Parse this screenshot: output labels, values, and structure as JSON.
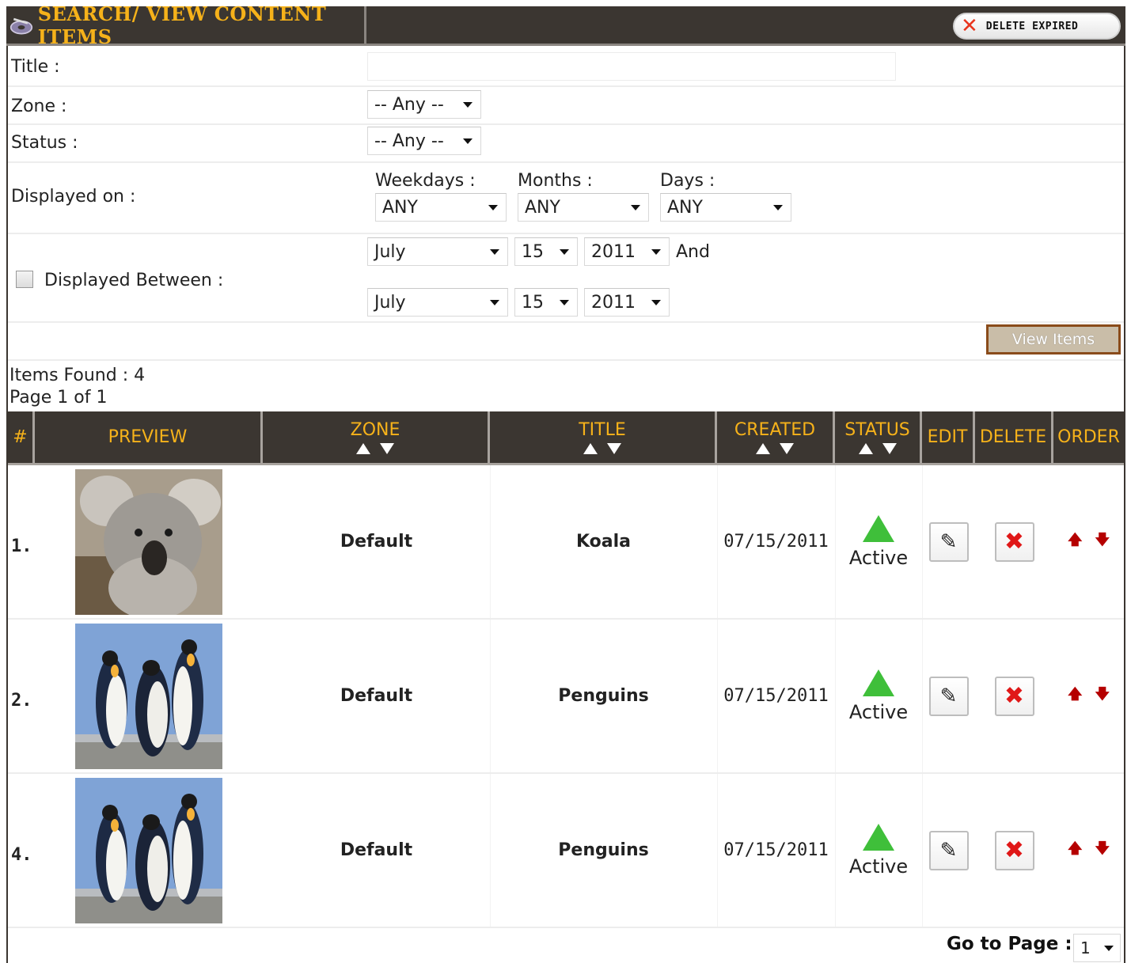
{
  "header": {
    "title": "SEARCH/ VIEW CONTENT ITEMS",
    "delete_expired_label": "DELETE EXPIRED"
  },
  "form": {
    "title_label": "Title :",
    "title_value": "",
    "zone_label": "Zone :",
    "zone_value": "-- Any --",
    "status_label": "Status :",
    "status_value": "-- Any --",
    "displayed_on_label": "Displayed on :",
    "weekdays_label": "Weekdays :",
    "weekdays_value": "ANY",
    "months_label": "Months :",
    "months_value": "ANY",
    "days_label": "Days :",
    "days_value": "ANY",
    "displayed_between_label": "Displayed Between :",
    "displayed_between_checked": false,
    "from_month": "July",
    "from_day": "15",
    "from_year": "2011",
    "and_label": "And",
    "to_month": "July",
    "to_day": "15",
    "to_year": "2011",
    "view_items_label": "View Items"
  },
  "results": {
    "items_found": "Items Found : 4",
    "page_info": "Page 1 of 1"
  },
  "table": {
    "headers": {
      "num": "#",
      "preview": "PREVIEW",
      "zone": "ZONE",
      "title": "TITLE",
      "created": "CREATED",
      "status": "STATUS",
      "edit": "EDIT",
      "delete": "DELETE",
      "order": "ORDER"
    },
    "rows": [
      {
        "num": "1.",
        "preview": "koala",
        "zone": "Default",
        "title": "Koala",
        "created": "07/15/2011",
        "status": "Active"
      },
      {
        "num": "2.",
        "preview": "penguins",
        "zone": "Default",
        "title": "Penguins",
        "created": "07/15/2011",
        "status": "Active"
      },
      {
        "num": "4.",
        "preview": "penguins",
        "zone": "Default",
        "title": "Penguins",
        "created": "07/15/2011",
        "status": "Active"
      }
    ]
  },
  "pagination": {
    "goto_label": "Go to Page :",
    "page_value": "1"
  },
  "colors": {
    "header_bg": "#3b3631",
    "header_text": "#f6b21a",
    "status_active": "#3fbf3a",
    "delete_red": "#e01818"
  }
}
